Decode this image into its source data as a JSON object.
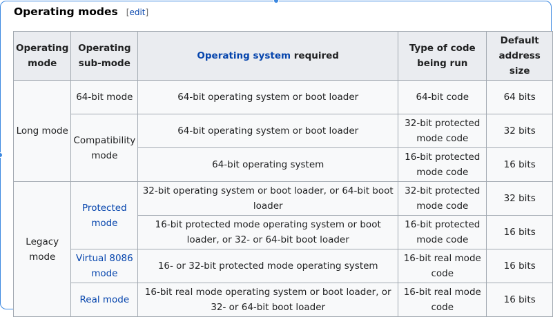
{
  "heading": {
    "title": "Operating modes",
    "edit_open": "[",
    "edit_label": "edit",
    "edit_close": "]"
  },
  "columns": {
    "mode": "Operating mode",
    "submode": "Operating sub-mode",
    "os_link": "Operating system",
    "os_rest": " required",
    "code": "Type of code being run",
    "addr": "Default address size"
  },
  "groups": {
    "long": "Long mode",
    "legacy": "Legacy mode"
  },
  "rows": [
    {
      "submode": "64-bit mode",
      "os": "64-bit operating system or boot loader",
      "code": "64-bit code",
      "addr": "64 bits"
    },
    {
      "submode": "Compatibility mode",
      "os": "64-bit operating system or boot loader",
      "code": "32-bit protected mode code",
      "addr": "32 bits"
    },
    {
      "os": "64-bit operating system",
      "code": "16-bit protected mode code",
      "addr": "16 bits"
    },
    {
      "submode": "Protected mode",
      "os": "32-bit operating system or boot loader, or 64-bit boot loader",
      "code": "32-bit protected mode code",
      "addr": "32 bits"
    },
    {
      "os": "16-bit protected mode operating system or boot loader, or 32- or 64-bit boot loader",
      "code": "16-bit protected mode code",
      "addr": "16 bits"
    },
    {
      "submode": "Virtual 8086 mode",
      "os": "16- or 32-bit protected mode operating system",
      "code": "16-bit real mode code",
      "addr": "16 bits"
    },
    {
      "submode": "Real mode",
      "os": "16-bit real mode operating system or boot loader, or 32- or 64-bit boot loader",
      "code": "16-bit real mode code",
      "addr": "16 bits"
    }
  ],
  "colors": {
    "selection": "#3a87e0",
    "link": "#0645ad",
    "border": "#a2a9b1",
    "header_bg": "#eaecf0",
    "cell_bg": "#f8f9fa"
  }
}
